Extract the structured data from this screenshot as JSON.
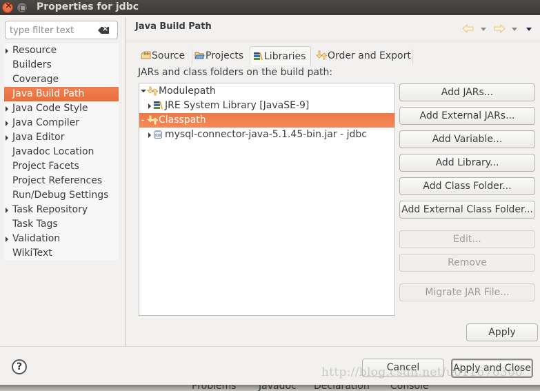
{
  "window": {
    "title": "Properties for jdbc"
  },
  "filter": {
    "placeholder": "type filter text",
    "value": ""
  },
  "sidebar": {
    "items": [
      {
        "label": "Resource",
        "expandable": true,
        "selected": false
      },
      {
        "label": "Builders",
        "expandable": false,
        "selected": false
      },
      {
        "label": "Coverage",
        "expandable": false,
        "selected": false
      },
      {
        "label": "Java Build Path",
        "expandable": false,
        "selected": true
      },
      {
        "label": "Java Code Style",
        "expandable": true,
        "selected": false
      },
      {
        "label": "Java Compiler",
        "expandable": true,
        "selected": false
      },
      {
        "label": "Java Editor",
        "expandable": true,
        "selected": false
      },
      {
        "label": "Javadoc Location",
        "expandable": false,
        "selected": false
      },
      {
        "label": "Project Facets",
        "expandable": false,
        "selected": false
      },
      {
        "label": "Project References",
        "expandable": false,
        "selected": false
      },
      {
        "label": "Run/Debug Settings",
        "expandable": false,
        "selected": false
      },
      {
        "label": "Task Repository",
        "expandable": true,
        "selected": false
      },
      {
        "label": "Task Tags",
        "expandable": false,
        "selected": false
      },
      {
        "label": "Validation",
        "expandable": true,
        "selected": false
      },
      {
        "label": "WikiText",
        "expandable": false,
        "selected": false
      }
    ]
  },
  "header": {
    "title": "Java Build Path",
    "nav_icons": [
      "back-arrow-icon",
      "back-history-dropdown-icon",
      "forward-arrow-icon",
      "forward-history-dropdown-icon",
      "view-menu-icon"
    ]
  },
  "tabs": [
    {
      "label": "Source",
      "icon": "source-folder-icon",
      "active": false
    },
    {
      "label": "Projects",
      "icon": "projects-folder-icon",
      "active": false
    },
    {
      "label": "Libraries",
      "icon": "libraries-icon",
      "active": true
    },
    {
      "label": "Order and Export",
      "icon": "order-export-icon",
      "active": false
    }
  ],
  "libraries": {
    "caption": "JARs and class folders on the build path:",
    "tree": [
      {
        "label": "Modulepath",
        "level": 0,
        "state": "expanded",
        "icon": "modulepath-icon",
        "selected": false
      },
      {
        "label": "JRE System Library [JavaSE-9]",
        "level": 1,
        "state": "collapsed",
        "icon": "library-icon",
        "selected": false
      },
      {
        "label": "Classpath",
        "level": 0,
        "state": "empty",
        "icon": "classpath-icon",
        "selected": true
      },
      {
        "label": "mysql-connector-java-5.1.45-bin.jar - jdbc",
        "level": 1,
        "state": "collapsed",
        "icon": "jar-icon",
        "selected": false
      }
    ],
    "buttons": [
      {
        "label": "Add JARs...",
        "enabled": true
      },
      {
        "label": "Add External JARs...",
        "enabled": true
      },
      {
        "label": "Add Variable...",
        "enabled": true
      },
      {
        "label": "Add Library...",
        "enabled": true
      },
      {
        "label": "Add Class Folder...",
        "enabled": true
      },
      {
        "label": "Add External Class Folder...",
        "enabled": true
      },
      {
        "label": "Edit...",
        "enabled": false
      },
      {
        "label": "Remove",
        "enabled": false
      },
      {
        "label": "Migrate JAR File...",
        "enabled": false
      }
    ]
  },
  "apply_label": "Apply",
  "footer": {
    "cancel_label": "Cancel",
    "apply_close_label": "Apply and Close"
  },
  "background_tabs": [
    "Problems",
    "Javadoc",
    "Declaration",
    "Console"
  ],
  "watermark": "http://blog.csdn.net/u011676300",
  "colors": {
    "selection": "#ee7a46",
    "titlebar": "#3c3b37"
  }
}
